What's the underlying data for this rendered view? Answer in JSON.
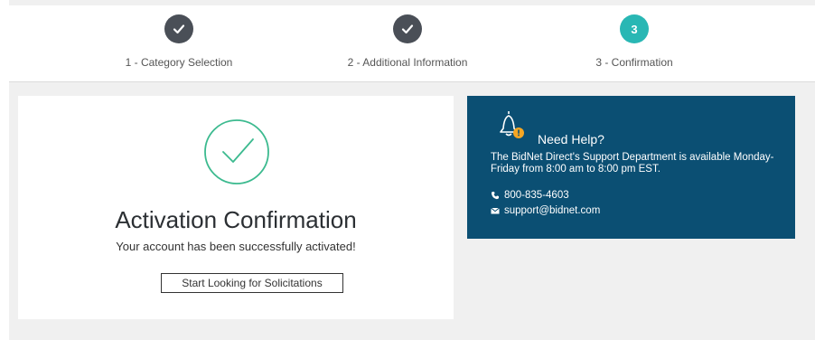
{
  "stepper": {
    "steps": [
      {
        "label": "1 - Category Selection",
        "state": "done",
        "icon": "check-icon"
      },
      {
        "label": "2 - Additional Information",
        "state": "done",
        "icon": "check-icon"
      },
      {
        "label": "3 - Confirmation",
        "state": "active",
        "number": "3"
      }
    ]
  },
  "confirmation": {
    "icon": "success-check-icon",
    "title": "Activation Confirmation",
    "message": "Your account has been successfully activated!",
    "button_label": "Start Looking for Solicitations"
  },
  "help": {
    "icon": "bell-alert-icon",
    "title": "Need Help?",
    "text": "The BidNet Direct's Support Department is available Monday-Friday from 8:00 am to 8:00 pm EST.",
    "phone": "800-835-4603",
    "email": "support@bidnet.com"
  },
  "colors": {
    "step_done": "#4a4f57",
    "step_active": "#29b7b4",
    "success_green": "#3cba8f",
    "help_bg": "#0b4f73",
    "alert_orange": "#f5a623"
  }
}
